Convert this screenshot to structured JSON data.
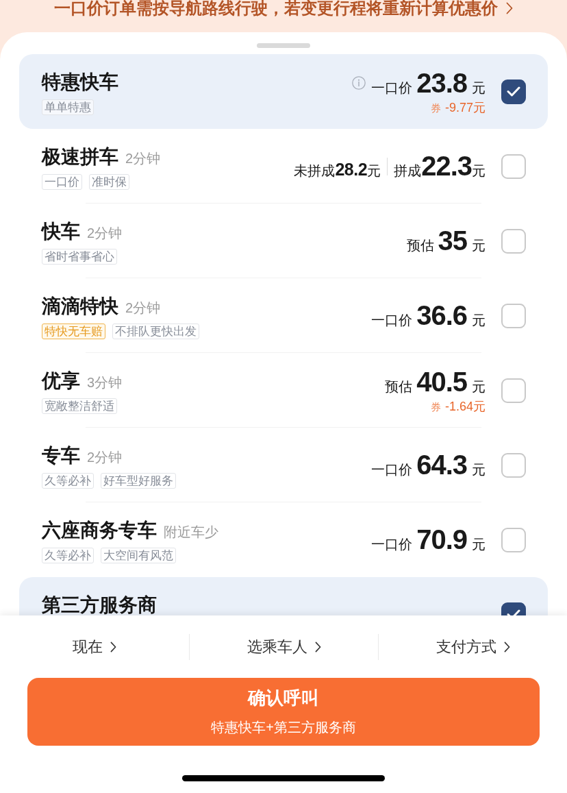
{
  "notice": {
    "text": "一口价订单需按导航路线行驶，若变更行程将重新计算优惠价"
  },
  "rides": [
    {
      "name": "特惠快车",
      "info": true,
      "selected": true,
      "tags": [
        {
          "text": "单单特惠",
          "kind": "plain"
        }
      ],
      "prices": [
        {
          "kind": "standard",
          "label": "一口价",
          "amount": "23.8",
          "unit": "元"
        }
      ],
      "coupon": {
        "label": "券",
        "amount": "-9.77元"
      }
    },
    {
      "name": "极速拼车",
      "note": "2分钟",
      "info": false,
      "selected": false,
      "tags": [
        {
          "text": "一口价",
          "kind": "plain"
        },
        {
          "text": "准时保",
          "kind": "plain"
        }
      ],
      "prices": [
        {
          "kind": "unpooled",
          "label": "未拼成",
          "amount": "28.2",
          "unit": "元"
        },
        {
          "kind": "pooled",
          "label": "拼成",
          "amount": "22.3",
          "unit": "元"
        }
      ]
    },
    {
      "name": "快车",
      "note": "2分钟",
      "info": false,
      "selected": false,
      "tags": [
        {
          "text": "省时省事省心",
          "kind": "plain"
        }
      ],
      "prices": [
        {
          "kind": "standard",
          "label": "预估",
          "amount": "35",
          "unit": "元"
        }
      ]
    },
    {
      "name": "滴滴特快",
      "note": "2分钟",
      "info": false,
      "selected": false,
      "tags": [
        {
          "text": "特快无车赔",
          "kind": "highlight"
        },
        {
          "text": "不排队更快出发",
          "kind": "plain"
        }
      ],
      "prices": [
        {
          "kind": "standard",
          "label": "一口价",
          "amount": "36.6",
          "unit": "元"
        }
      ]
    },
    {
      "name": "优享",
      "note": "3分钟",
      "info": false,
      "selected": false,
      "tags": [
        {
          "text": "宽敞整洁舒适",
          "kind": "plain"
        }
      ],
      "prices": [
        {
          "kind": "standard",
          "label": "预估",
          "amount": "40.5",
          "unit": "元"
        }
      ],
      "coupon": {
        "label": "券",
        "amount": "-1.64元"
      }
    },
    {
      "name": "专车",
      "note": "2分钟",
      "info": false,
      "selected": false,
      "tags": [
        {
          "text": "久等必补",
          "kind": "plain"
        },
        {
          "text": "好车型好服务",
          "kind": "plain"
        }
      ],
      "prices": [
        {
          "kind": "standard",
          "label": "一口价",
          "amount": "64.3",
          "unit": "元"
        }
      ]
    },
    {
      "name": "六座商务专车",
      "note": "附近车少",
      "info": false,
      "selected": false,
      "tags": [
        {
          "text": "久等必补",
          "kind": "plain"
        },
        {
          "text": "大空间有风范",
          "kind": "plain"
        }
      ],
      "prices": [
        {
          "kind": "standard",
          "label": "一口价",
          "amount": "70.9",
          "unit": "元"
        }
      ]
    },
    {
      "name": "第三方服务商",
      "info": false,
      "selected": true
    }
  ],
  "options": [
    {
      "label": "现在"
    },
    {
      "label": "选乘车人"
    },
    {
      "label": "支付方式"
    }
  ],
  "confirm": {
    "title": "确认呼叫",
    "subtitle": "特惠快车+第三方服务商"
  }
}
